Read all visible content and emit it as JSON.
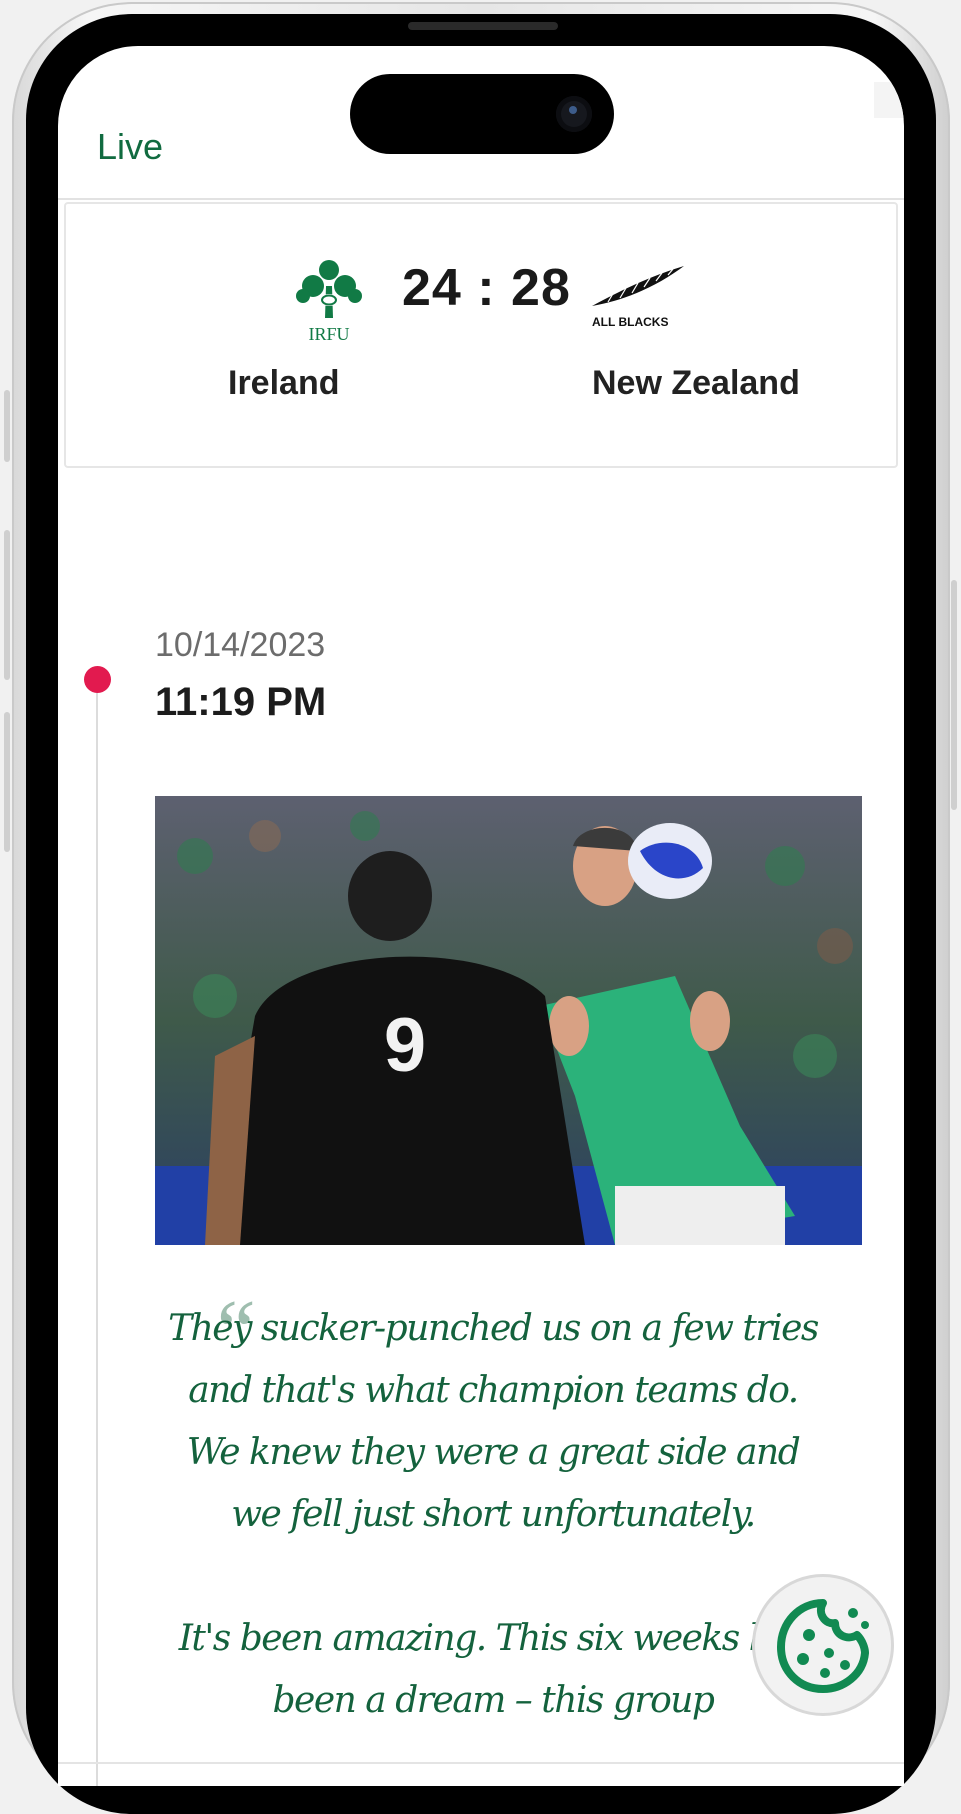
{
  "header": {
    "title": "Live"
  },
  "match": {
    "home_team": "Ireland",
    "away_team": "New Zealand",
    "home_logo_text": "IRFU",
    "away_logo_text": "ALL BLACKS",
    "score_display": "24 : 28",
    "home_score": 24,
    "away_score": 28
  },
  "timeline": {
    "entries": [
      {
        "date": "10/14/2023",
        "time": "11:19 PM",
        "quote": "They sucker-punched us on a few tries and that's what champion teams do. We knew they were a great side and we fell just short unfortunately.\n\nIt's been amazing. This six weeks has been a dream – this group"
      }
    ]
  },
  "colors": {
    "accent_green": "#116b40",
    "quote_green": "#14623d",
    "timeline_dot": "#e21a4f"
  },
  "icons": {
    "cookie_button": "cookie-icon",
    "home_logo": "shamrock-icon",
    "away_logo": "silver-fern-icon"
  }
}
